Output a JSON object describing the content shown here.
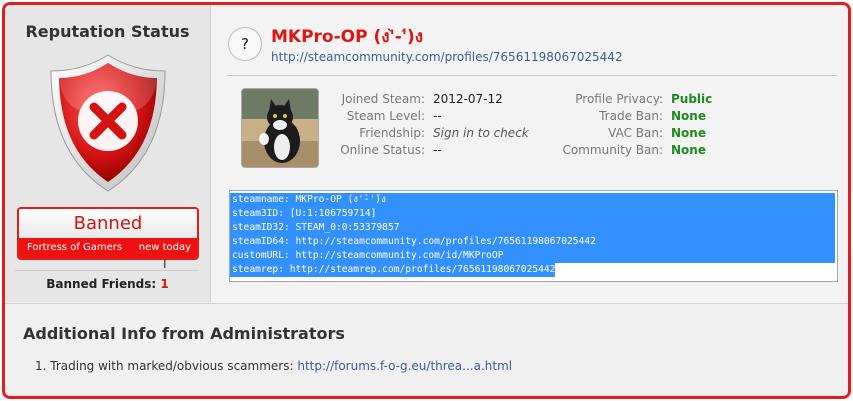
{
  "left": {
    "title": "Reputation Status",
    "banned": {
      "label": "Banned",
      "source": "Fortress of Gamers",
      "when": "new today"
    },
    "banned_friends_label": "Banned Friends: ",
    "banned_friends_count": "1"
  },
  "profile": {
    "name": "MKPro-OP (ง'̀-'́)ง",
    "url": "http://steamcommunity.com/profiles/76561198067025442",
    "help_icon": "?"
  },
  "info_left": [
    {
      "label": "Joined Steam:",
      "value": "2012-07-12"
    },
    {
      "label": "Steam Level:",
      "value": "--"
    },
    {
      "label": "Friendship:",
      "value": "Sign in to check"
    },
    {
      "label": "Online Status:",
      "value": "--"
    }
  ],
  "info_right": [
    {
      "label": "Profile Privacy:",
      "value": "Public"
    },
    {
      "label": "Trade Ban:",
      "value": "None"
    },
    {
      "label": "VAC Ban:",
      "value": "None"
    },
    {
      "label": "Community Ban:",
      "value": "None"
    }
  ],
  "ids": [
    "steamname: MKPro-OP (ง'̀-'́)ง",
    "steam3ID: [U:1:106759714]",
    "steamID32: STEAM_0:0:53379857",
    "steamID64: http://steamcommunity.com/profiles/76561198067025442",
    "customURL: http://steamcommunity.com/id/MKProOP",
    "steamrep: http://steamrep.com/profiles/76561198067025442"
  ],
  "admin": {
    "title": "Additional Info from Administrators",
    "item_text": "1. Trading with marked/obvious scammers: ",
    "item_link": "http://forums.f-o-g.eu/threa...a.html"
  },
  "colors": {
    "border": "#e31c1c",
    "accent_red": "#d01515",
    "good_green": "#1f8a1f",
    "link_blue": "#3a5f8f",
    "selection_blue": "#3390ff"
  },
  "icons": [
    "shield-x-icon",
    "help-icon",
    "avatar-cat"
  ]
}
